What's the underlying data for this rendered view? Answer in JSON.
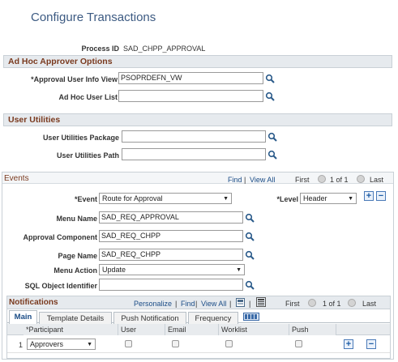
{
  "page_title": "Configure Transactions",
  "process": {
    "label": "Process ID",
    "value": "SAD_CHPP_APPROVAL"
  },
  "adhoc": {
    "header": "Ad Hoc Approver Options",
    "approval_user_info_view": {
      "label": "*Approval User Info View",
      "value": "PSOPRDEFN_VW"
    },
    "adhoc_user_list": {
      "label": "Ad Hoc User List",
      "value": ""
    }
  },
  "user_utilities": {
    "header": "User Utilities",
    "package": {
      "label": "User Utilities Package",
      "value": ""
    },
    "path": {
      "label": "User Utilities Path",
      "value": ""
    }
  },
  "events": {
    "header": "Events",
    "find": "Find",
    "view_all": "View All",
    "first": "First",
    "pager": "1 of 1",
    "last": "Last",
    "event": {
      "label": "*Event",
      "value": "Route for Approval"
    },
    "level": {
      "label": "*Level",
      "value": "Header"
    },
    "menu_name": {
      "label": "Menu Name",
      "value": "SAD_REQ_APPROVAL"
    },
    "approval_component": {
      "label": "Approval Component",
      "value": "SAD_REQ_CHPP"
    },
    "page_name": {
      "label": "Page Name",
      "value": "SAD_REQ_CHPP"
    },
    "menu_action": {
      "label": "Menu Action",
      "value": "Update"
    },
    "sql_object": {
      "label": "SQL Object Identifier",
      "value": ""
    }
  },
  "notifications": {
    "header": "Notifications",
    "personalize": "Personalize",
    "find": "Find",
    "view_all": "View All",
    "first": "First",
    "pager": "1 of 1",
    "last": "Last",
    "tabs": [
      "Main",
      "Template Details",
      "Push Notification",
      "Frequency"
    ],
    "columns": [
      "*Participant",
      "User",
      "Email",
      "Worklist",
      "Push"
    ],
    "rows": [
      {
        "num": "1",
        "participant": "Approvers"
      }
    ]
  },
  "colors": {
    "title": "#3c5a82",
    "section_header_text": "#7a3a1f",
    "link": "#1a4c86"
  }
}
